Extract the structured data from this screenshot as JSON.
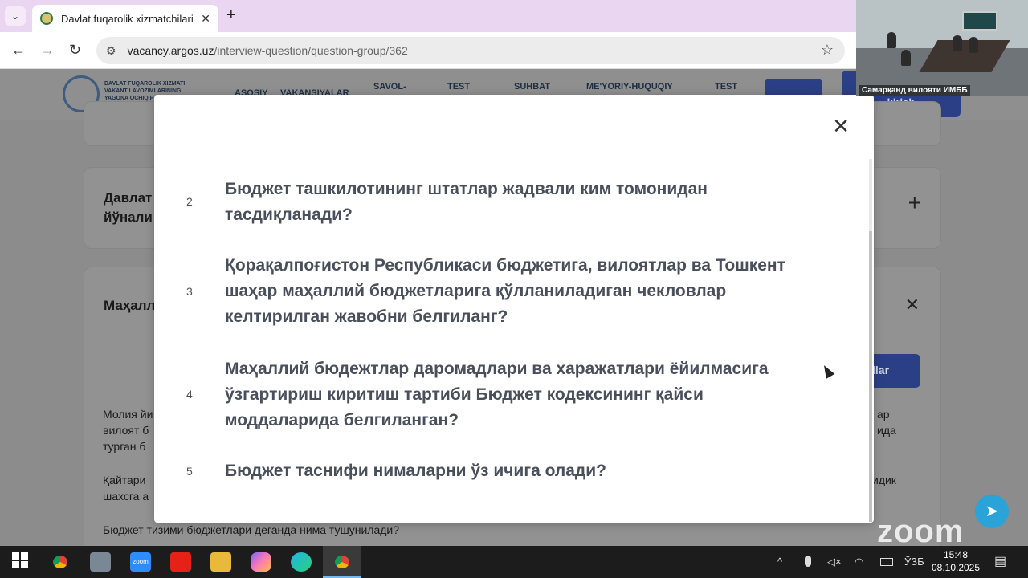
{
  "browser": {
    "tab_title": "Davlat fuqarolik xizmatchilari va",
    "url_host": "vacancy.argos.uz",
    "url_path": "/interview-question/question-group/362",
    "new_tab_symbol": "+",
    "tab_close_symbol": "✕",
    "tab_list_symbol": "⌄",
    "back_symbol": "←",
    "forward_symbol": "→",
    "reload_symbol": "↻",
    "star_symbol": "☆",
    "site_info_symbol": "⚙"
  },
  "site": {
    "logo_lines": "DAVLAT FUQAROLIK XIZMATI VAKANT LAVOZIMLARINING YAGONA OCHIQ PO",
    "nav": [
      "ASOSIY",
      "VAKANSIYALAR",
      "SAVOL-",
      "TEST",
      "SUHBAT",
      "ME'YORIY-HUQUQIY",
      "TEST"
    ],
    "login_label": "kirish",
    "card2_title_line1": "Давлат",
    "card2_title_line2": "йўнали",
    "card3_title": "Маҳалл",
    "blue_btn_label": "llar",
    "bg_text_left1": "Молия йи",
    "bg_text_left2": "вилоят б",
    "bg_text_left3": "турган б",
    "bg_text_left4": "Қайтари",
    "bg_text_left5": "шахсга а",
    "bg_text_right1": "ар",
    "bg_text_right2": "ида",
    "bg_text_right3": "идик",
    "bg_text_bottom": "Бюджет тизими бюджетлари деганда нима тушунилади?",
    "plus_symbol": "+",
    "x_symbol": "✕"
  },
  "modal": {
    "close_symbol": "✕",
    "questions": [
      {
        "num": "2",
        "text": "Бюджет ташкилотининг штатлар жадвали ким томонидан тасдиқланади?"
      },
      {
        "num": "3",
        "text": "Қорақалпоғистон Республикаси бюджетига, вилоятлар ва Тошкент шаҳар маҳаллий бюджетларига қўлланиладиган чекловлар келтирилган жавобни белгиланг?"
      },
      {
        "num": "4",
        "text": "Маҳаллий бюдежтлар даромадлари ва харажатлари ёйилмасига ўзгартириш киритиш тартиби Бюджет кодексининг қайси моддаларида белгиланган?"
      },
      {
        "num": "5",
        "text": "Бюджет таснифи нималарни ўз ичига олади?"
      }
    ]
  },
  "video": {
    "caption": "Самарқанд вилояти ИМББ"
  },
  "zoom_watermark": "zoom",
  "telegram_symbol": "➤",
  "taskbar": {
    "lang": "ЎЗБ",
    "time": "15:48",
    "date": "08.10.2025",
    "zoom_label": "zoom",
    "tray_chevron": "^",
    "notify_symbol": "▤"
  },
  "colors": {
    "tab_strip": "#ead6f0",
    "primary_button": "#2b3f86",
    "question_text": "#4a4f5c",
    "telegram": "#2aa3d8"
  }
}
